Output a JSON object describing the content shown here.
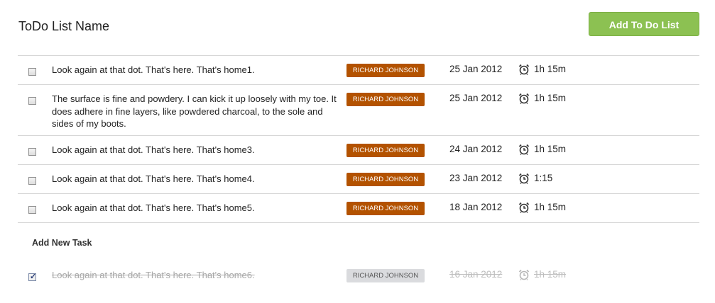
{
  "header": {
    "title": "ToDo List Name",
    "add_list_label": "Add To Do List"
  },
  "tasks": [
    {
      "text": "Look again at that dot. That's here. That's home1.",
      "assignee": "RICHARD JOHNSON",
      "date": "25 Jan 2012",
      "duration": "1h 15m",
      "checked": false
    },
    {
      "text": "The surface is fine and powdery. I can kick it up loosely with my toe. It does adhere in fine layers, like powdered charcoal, to the sole and sides of my boots.",
      "assignee": "RICHARD JOHNSON",
      "date": "25 Jan 2012",
      "duration": "1h 15m",
      "checked": false
    },
    {
      "text": "Look again at that dot. That's here. That's home3.",
      "assignee": "RICHARD JOHNSON",
      "date": "24 Jan 2012",
      "duration": "1h 15m",
      "checked": false
    },
    {
      "text": "Look again at that dot. That's here. That's home4.",
      "assignee": "RICHARD JOHNSON",
      "date": "23 Jan 2012",
      "duration": "1:15",
      "checked": false
    },
    {
      "text": "Look again at that dot. That's here. That's home5.",
      "assignee": "RICHARD JOHNSON",
      "date": "18 Jan 2012",
      "duration": "1h 15m",
      "checked": false
    }
  ],
  "add_new_task_label": "Add New Task",
  "completed_task": {
    "text": "Look again at that dot. That's here. That's home6.",
    "assignee": "RICHARD JOHNSON",
    "date": "16 Jan 2012",
    "duration": "1h 15m",
    "checked": true
  },
  "icons": {
    "checkbox": "checkbox-icon",
    "clock": "alarm-clock-icon"
  },
  "colors": {
    "accent_button": "#8cc152",
    "assignee_badge": "#b35200",
    "assignee_badge_done": "#dadbde",
    "divider": "#d6d6d6"
  }
}
